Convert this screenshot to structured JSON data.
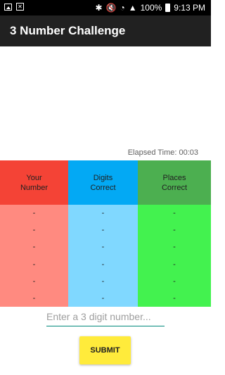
{
  "status_bar": {
    "battery": "100%",
    "time": "9:13 PM",
    "icons": [
      "image-icon",
      "x-icon",
      "bluetooth-icon",
      "mute-icon",
      "wifi-icon",
      "signal-icon",
      "battery-icon"
    ]
  },
  "app_bar": {
    "title": "3 Number Challenge"
  },
  "elapsed": {
    "text": "Elapsed Time: 00:03"
  },
  "table": {
    "headers": [
      {
        "line1": "Your",
        "line2": "Number",
        "header_color": "#f44336",
        "body_color": "#ff8a80"
      },
      {
        "line1": "Digits",
        "line2": "Correct",
        "header_color": "#03a9f4",
        "body_color": "#80d8ff"
      },
      {
        "line1": "Places",
        "line2": "Correct",
        "header_color": "#4caf50",
        "body_color": "#43f24f"
      }
    ],
    "rows": [
      [
        "-",
        "-",
        "-"
      ],
      [
        "-",
        "-",
        "-"
      ],
      [
        "-",
        "-",
        "-"
      ],
      [
        "-",
        "-",
        "-"
      ],
      [
        "-",
        "-",
        "-"
      ],
      [
        "-",
        "-",
        "-"
      ]
    ]
  },
  "input": {
    "placeholder": "Enter a 3 digit number...",
    "value": ""
  },
  "submit": {
    "label": "SUBMIT"
  }
}
